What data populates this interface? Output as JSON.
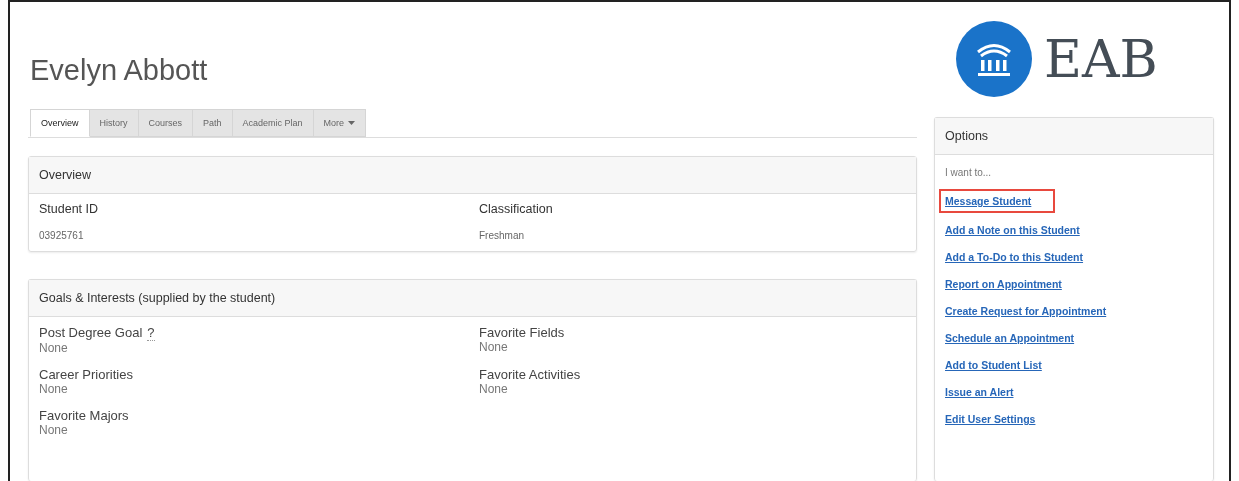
{
  "student_name": "Evelyn Abbott",
  "logo": {
    "text": "EAB"
  },
  "tabs": [
    {
      "label": "Overview",
      "selected": true,
      "dropdown": false
    },
    {
      "label": "History",
      "selected": false,
      "dropdown": false
    },
    {
      "label": "Courses",
      "selected": false,
      "dropdown": false
    },
    {
      "label": "Path",
      "selected": false,
      "dropdown": false
    },
    {
      "label": "Academic Plan",
      "selected": false,
      "dropdown": false
    },
    {
      "label": "More",
      "selected": false,
      "dropdown": true
    }
  ],
  "overview": {
    "title": "Overview",
    "fields": [
      {
        "label": "Student ID",
        "value": "03925761"
      },
      {
        "label": "Classification",
        "value": "Freshman"
      }
    ]
  },
  "goals": {
    "title": "Goals & Interests (supplied by the student)",
    "fields": [
      {
        "label": "Post Degree Goal",
        "help": "?",
        "value": "None"
      },
      {
        "label": "Favorite Fields",
        "value": "None"
      },
      {
        "label": "Career Priorities",
        "value": "None"
      },
      {
        "label": "Favorite Activities",
        "value": "None"
      },
      {
        "label": "Favorite Majors",
        "value": "None"
      }
    ]
  },
  "options": {
    "title": "Options",
    "intro": "I want to...",
    "links": [
      {
        "label": "Message Student",
        "highlighted": true
      },
      {
        "label": "Add a Note on this Student",
        "highlighted": false
      },
      {
        "label": "Add a To-Do to this Student",
        "highlighted": false
      },
      {
        "label": "Report on Appointment",
        "highlighted": false
      },
      {
        "label": "Create Request for Appointment",
        "highlighted": false
      },
      {
        "label": "Schedule an Appointment",
        "highlighted": false
      },
      {
        "label": "Add to Student List",
        "highlighted": false
      },
      {
        "label": "Issue an Alert",
        "highlighted": false
      },
      {
        "label": "Edit User Settings",
        "highlighted": false
      }
    ]
  }
}
